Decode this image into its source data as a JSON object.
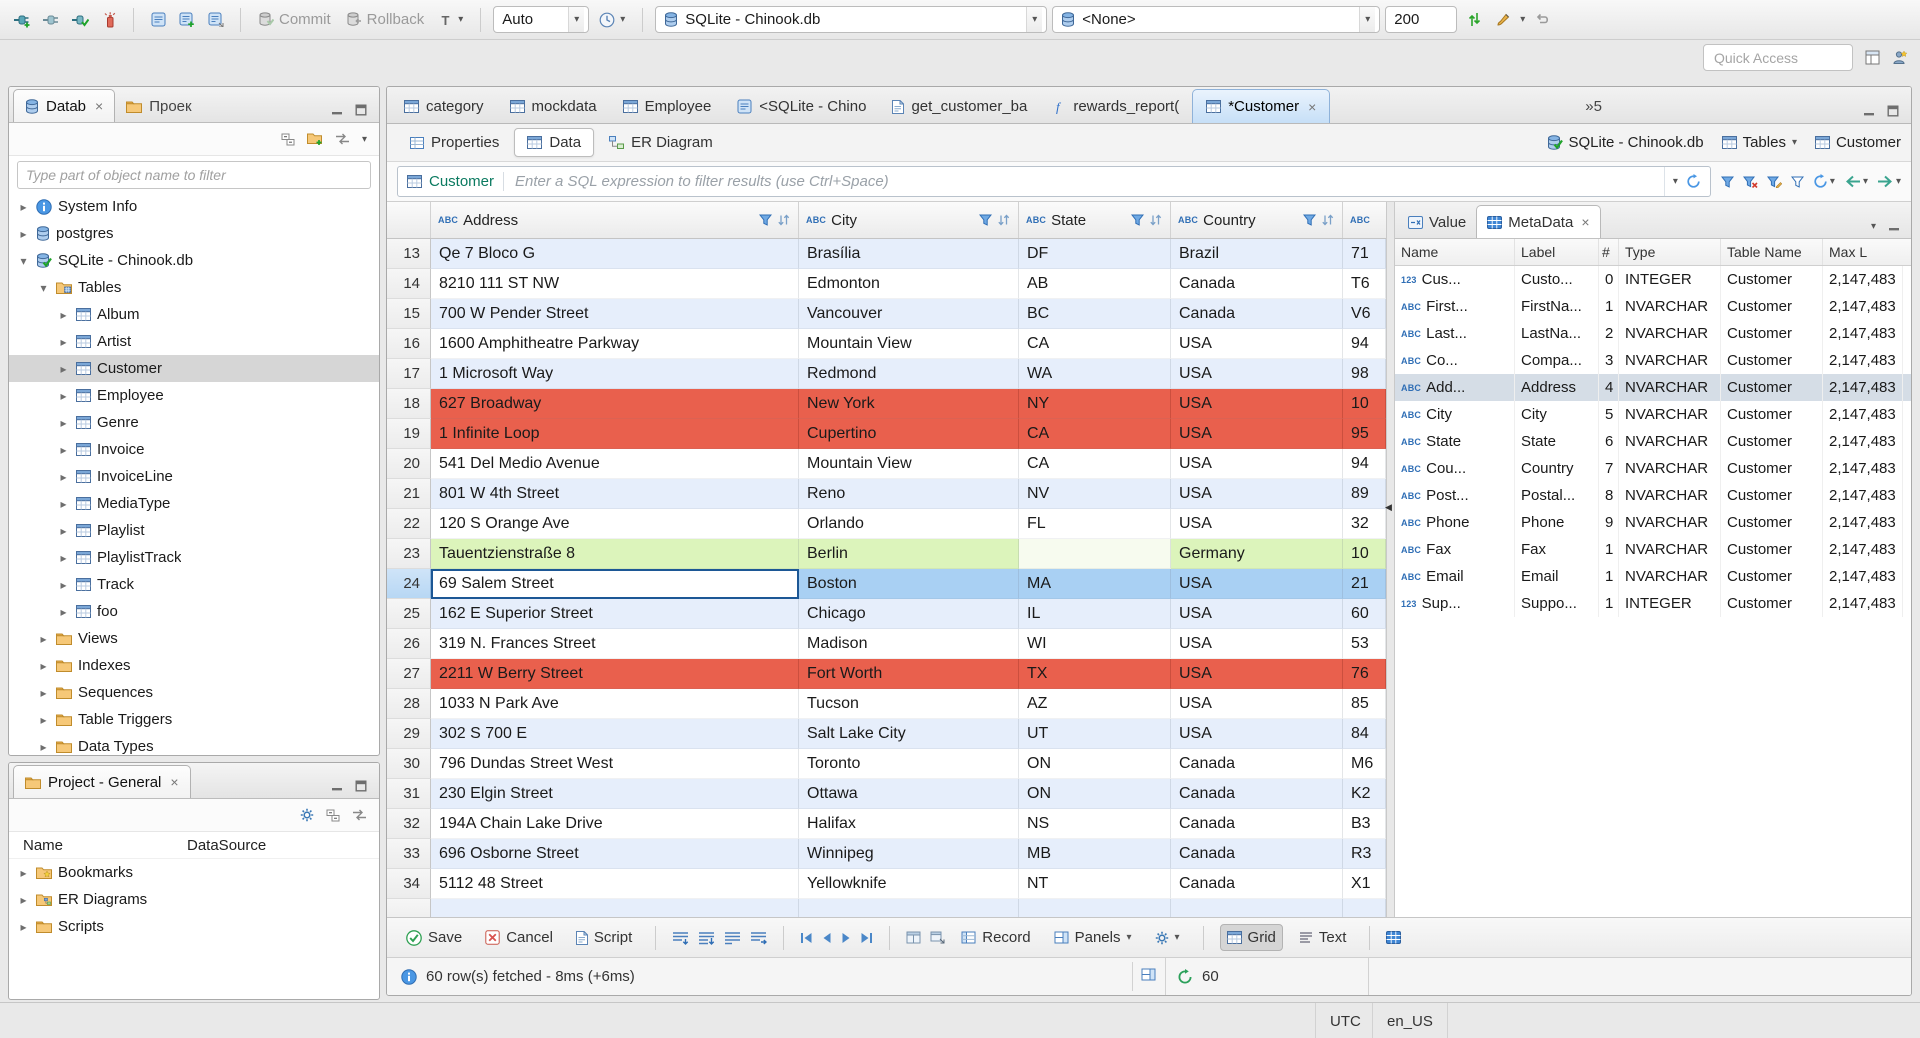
{
  "toolbar": {
    "commit_label": "Commit",
    "rollback_label": "Rollback",
    "auto_label": "Auto",
    "db_combo": "SQLite - Chinook.db",
    "schema_combo": "<None>",
    "fetch_size": "200",
    "quick_access_placeholder": "Quick Access"
  },
  "navigator": {
    "tab_database": "Datab",
    "tab_projects": "Проек",
    "filter_placeholder": "Type part of object name to filter",
    "tree": [
      {
        "label": "System Info",
        "level": 1,
        "arrow": "right",
        "icon": "info"
      },
      {
        "label": "postgres",
        "level": 1,
        "arrow": "right",
        "icon": "dbBlue"
      },
      {
        "label": "SQLite - Chinook.db",
        "level": 1,
        "arrow": "down",
        "icon": "dbCheck"
      },
      {
        "label": "Tables",
        "level": 2,
        "arrow": "down",
        "icon": "folderDb"
      },
      {
        "label": "Album",
        "level": 3,
        "arrow": "right",
        "icon": "table"
      },
      {
        "label": "Artist",
        "level": 3,
        "arrow": "right",
        "icon": "table"
      },
      {
        "label": "Customer",
        "level": 3,
        "arrow": "right",
        "icon": "table",
        "selected": true
      },
      {
        "label": "Employee",
        "level": 3,
        "arrow": "right",
        "icon": "table"
      },
      {
        "label": "Genre",
        "level": 3,
        "arrow": "right",
        "icon": "table"
      },
      {
        "label": "Invoice",
        "level": 3,
        "arrow": "right",
        "icon": "table"
      },
      {
        "label": "InvoiceLine",
        "level": 3,
        "arrow": "right",
        "icon": "table"
      },
      {
        "label": "MediaType",
        "level": 3,
        "arrow": "right",
        "icon": "table"
      },
      {
        "label": "Playlist",
        "level": 3,
        "arrow": "right",
        "icon": "table"
      },
      {
        "label": "PlaylistTrack",
        "level": 3,
        "arrow": "right",
        "icon": "table"
      },
      {
        "label": "Track",
        "level": 3,
        "arrow": "right",
        "icon": "table"
      },
      {
        "label": "foo",
        "level": 3,
        "arrow": "right",
        "icon": "table"
      },
      {
        "label": "Views",
        "level": 2,
        "arrow": "right",
        "icon": "folder"
      },
      {
        "label": "Indexes",
        "level": 2,
        "arrow": "right",
        "icon": "folder"
      },
      {
        "label": "Sequences",
        "level": 2,
        "arrow": "right",
        "icon": "folder"
      },
      {
        "label": "Table Triggers",
        "level": 2,
        "arrow": "right",
        "icon": "folder"
      },
      {
        "label": "Data Types",
        "level": 2,
        "arrow": "right",
        "icon": "folder"
      }
    ]
  },
  "project_panel": {
    "tab": "Project - General",
    "col_name": "Name",
    "col_datasource": "DataSource",
    "items": [
      {
        "label": "Bookmarks",
        "level": 1,
        "arrow": "right",
        "icon": "folderStar"
      },
      {
        "label": "ER Diagrams",
        "level": 1,
        "arrow": "right",
        "icon": "folderEr"
      },
      {
        "label": "Scripts",
        "level": 1,
        "arrow": "right",
        "icon": "folder"
      }
    ]
  },
  "editor_tabs": {
    "tabs": [
      {
        "label": "category",
        "icon": "table"
      },
      {
        "label": "mockdata",
        "icon": "table"
      },
      {
        "label": "Employee",
        "icon": "table"
      },
      {
        "label": "<SQLite - Chino",
        "icon": "sqlDoc"
      },
      {
        "label": "get_customer_ba",
        "icon": "sqlPage"
      },
      {
        "label": "rewards_report(",
        "icon": "func"
      },
      {
        "label": "*Customer",
        "icon": "table",
        "active": true,
        "closable": true
      }
    ],
    "overflow": "»5"
  },
  "result_tabs": {
    "properties": "Properties",
    "data": "Data",
    "er": "ER Diagram",
    "ctx_db": "SQLite - Chinook.db",
    "ctx_container": "Tables",
    "ctx_entity": "Customer"
  },
  "filter_bar": {
    "entity": "Customer",
    "placeholder": "Enter a SQL expression to filter results (use Ctrl+Space)"
  },
  "grid": {
    "columns": [
      {
        "name": "Address",
        "kind": "ABC"
      },
      {
        "name": "City",
        "kind": "ABC"
      },
      {
        "name": "State",
        "kind": "ABC"
      },
      {
        "name": "Country",
        "kind": "ABC"
      },
      {
        "name": "",
        "kind": "ABC"
      }
    ],
    "rows": [
      {
        "num": "13",
        "address": "Qe 7 Bloco G",
        "city": "Brasília",
        "state": "DF",
        "country": "Brazil",
        "postal": "71",
        "variant": "alt"
      },
      {
        "num": "14",
        "address": "8210 111 ST NW",
        "city": "Edmonton",
        "state": "AB",
        "country": "Canada",
        "postal": "T6",
        "variant": "plain"
      },
      {
        "num": "15",
        "address": "700 W Pender Street",
        "city": "Vancouver",
        "state": "BC",
        "country": "Canada",
        "postal": "V6",
        "variant": "alt"
      },
      {
        "num": "16",
        "address": "1600 Amphitheatre Parkway",
        "city": "Mountain View",
        "state": "CA",
        "country": "USA",
        "postal": "94",
        "variant": "plain"
      },
      {
        "num": "17",
        "address": "1 Microsoft Way",
        "city": "Redmond",
        "state": "WA",
        "country": "USA",
        "postal": "98",
        "variant": "alt"
      },
      {
        "num": "18",
        "address": "627 Broadway",
        "city": "New York",
        "state": "NY",
        "country": "USA",
        "postal": "10",
        "variant": "red"
      },
      {
        "num": "19",
        "address": "1 Infinite Loop",
        "city": "Cupertino",
        "state": "CA",
        "country": "USA",
        "postal": "95",
        "variant": "red"
      },
      {
        "num": "20",
        "address": "541 Del Medio Avenue",
        "city": "Mountain View",
        "state": "CA",
        "country": "USA",
        "postal": "94",
        "variant": "plain"
      },
      {
        "num": "21",
        "address": "801 W 4th Street",
        "city": "Reno",
        "state": "NV",
        "country": "USA",
        "postal": "89",
        "variant": "alt"
      },
      {
        "num": "22",
        "address": "120 S Orange Ave",
        "city": "Orlando",
        "state": "FL",
        "country": "USA",
        "postal": "32",
        "variant": "plain"
      },
      {
        "num": "23",
        "address": "Tauentzienstraße 8",
        "city": "Berlin",
        "state": "",
        "country": "Germany",
        "postal": "10",
        "variant": "green"
      },
      {
        "num": "24",
        "address": "69 Salem Street",
        "city": "Boston",
        "state": "MA",
        "country": "USA",
        "postal": "21",
        "variant": "selected"
      },
      {
        "num": "25",
        "address": "162 E Superior Street",
        "city": "Chicago",
        "state": "IL",
        "country": "USA",
        "postal": "60",
        "variant": "alt"
      },
      {
        "num": "26",
        "address": "319 N. Frances Street",
        "city": "Madison",
        "state": "WI",
        "country": "USA",
        "postal": "53",
        "variant": "plain"
      },
      {
        "num": "27",
        "address": "2211 W Berry Street",
        "city": "Fort Worth",
        "state": "TX",
        "country": "USA",
        "postal": "76",
        "variant": "red"
      },
      {
        "num": "28",
        "address": "1033 N Park Ave",
        "city": "Tucson",
        "state": "AZ",
        "country": "USA",
        "postal": "85",
        "variant": "plain"
      },
      {
        "num": "29",
        "address": "302 S 700 E",
        "city": "Salt Lake City",
        "state": "UT",
        "country": "USA",
        "postal": "84",
        "variant": "alt"
      },
      {
        "num": "30",
        "address": "796 Dundas Street West",
        "city": "Toronto",
        "state": "ON",
        "country": "Canada",
        "postal": "M6",
        "variant": "plain"
      },
      {
        "num": "31",
        "address": "230 Elgin Street",
        "city": "Ottawa",
        "state": "ON",
        "country": "Canada",
        "postal": "K2",
        "variant": "alt"
      },
      {
        "num": "32",
        "address": "194A Chain Lake Drive",
        "city": "Halifax",
        "state": "NS",
        "country": "Canada",
        "postal": "B3",
        "variant": "plain"
      },
      {
        "num": "33",
        "address": "696 Osborne Street",
        "city": "Winnipeg",
        "state": "MB",
        "country": "Canada",
        "postal": "R3",
        "variant": "alt"
      },
      {
        "num": "34",
        "address": "5112 48 Street",
        "city": "Yellowknife",
        "state": "NT",
        "country": "Canada",
        "postal": "X1",
        "variant": "plain"
      }
    ]
  },
  "metadata": {
    "tab_value": "Value",
    "tab_metadata": "MetaData",
    "columns": [
      "Name",
      "Label",
      "#",
      "Type",
      "Table Name",
      "Max L"
    ],
    "rows": [
      {
        "kind": "123",
        "name": "Cus...",
        "label": "Custo...",
        "num": "0",
        "type": "INTEGER",
        "table": "Customer",
        "max": "2,147,483"
      },
      {
        "kind": "ABC",
        "name": "First...",
        "label": "FirstNa...",
        "num": "1",
        "type": "NVARCHAR",
        "table": "Customer",
        "max": "2,147,483"
      },
      {
        "kind": "ABC",
        "name": "Last...",
        "label": "LastNa...",
        "num": "2",
        "type": "NVARCHAR",
        "table": "Customer",
        "max": "2,147,483"
      },
      {
        "kind": "ABC",
        "name": "Co...",
        "label": "Compa...",
        "num": "3",
        "type": "NVARCHAR",
        "table": "Customer",
        "max": "2,147,483"
      },
      {
        "kind": "ABC",
        "name": "Add...",
        "label": "Address",
        "num": "4",
        "type": "NVARCHAR",
        "table": "Customer",
        "max": "2,147,483",
        "selected": true
      },
      {
        "kind": "ABC",
        "name": "City",
        "label": "City",
        "num": "5",
        "type": "NVARCHAR",
        "table": "Customer",
        "max": "2,147,483"
      },
      {
        "kind": "ABC",
        "name": "State",
        "label": "State",
        "num": "6",
        "type": "NVARCHAR",
        "table": "Customer",
        "max": "2,147,483"
      },
      {
        "kind": "ABC",
        "name": "Cou...",
        "label": "Country",
        "num": "7",
        "type": "NVARCHAR",
        "table": "Customer",
        "max": "2,147,483"
      },
      {
        "kind": "ABC",
        "name": "Post...",
        "label": "Postal...",
        "num": "8",
        "type": "NVARCHAR",
        "table": "Customer",
        "max": "2,147,483"
      },
      {
        "kind": "ABC",
        "name": "Phone",
        "label": "Phone",
        "num": "9",
        "type": "NVARCHAR",
        "table": "Customer",
        "max": "2,147,483"
      },
      {
        "kind": "ABC",
        "name": "Fax",
        "label": "Fax",
        "num": "1",
        "type": "NVARCHAR",
        "table": "Customer",
        "max": "2,147,483"
      },
      {
        "kind": "ABC",
        "name": "Email",
        "label": "Email",
        "num": "1",
        "type": "NVARCHAR",
        "table": "Customer",
        "max": "2,147,483"
      },
      {
        "kind": "123",
        "name": "Sup...",
        "label": "Suppo...",
        "num": "1",
        "type": "INTEGER",
        "table": "Customer",
        "max": "2,147,483"
      }
    ]
  },
  "bottom_toolbar": {
    "save": "Save",
    "cancel": "Cancel",
    "script": "Script",
    "record": "Record",
    "panels": "Panels",
    "grid": "Grid",
    "text": "Text"
  },
  "status": {
    "fetched": "60 row(s) fetched - 8ms (+6ms)",
    "refresh_count": "60"
  },
  "statusbar": {
    "timezone": "UTC",
    "locale": "en_US"
  }
}
